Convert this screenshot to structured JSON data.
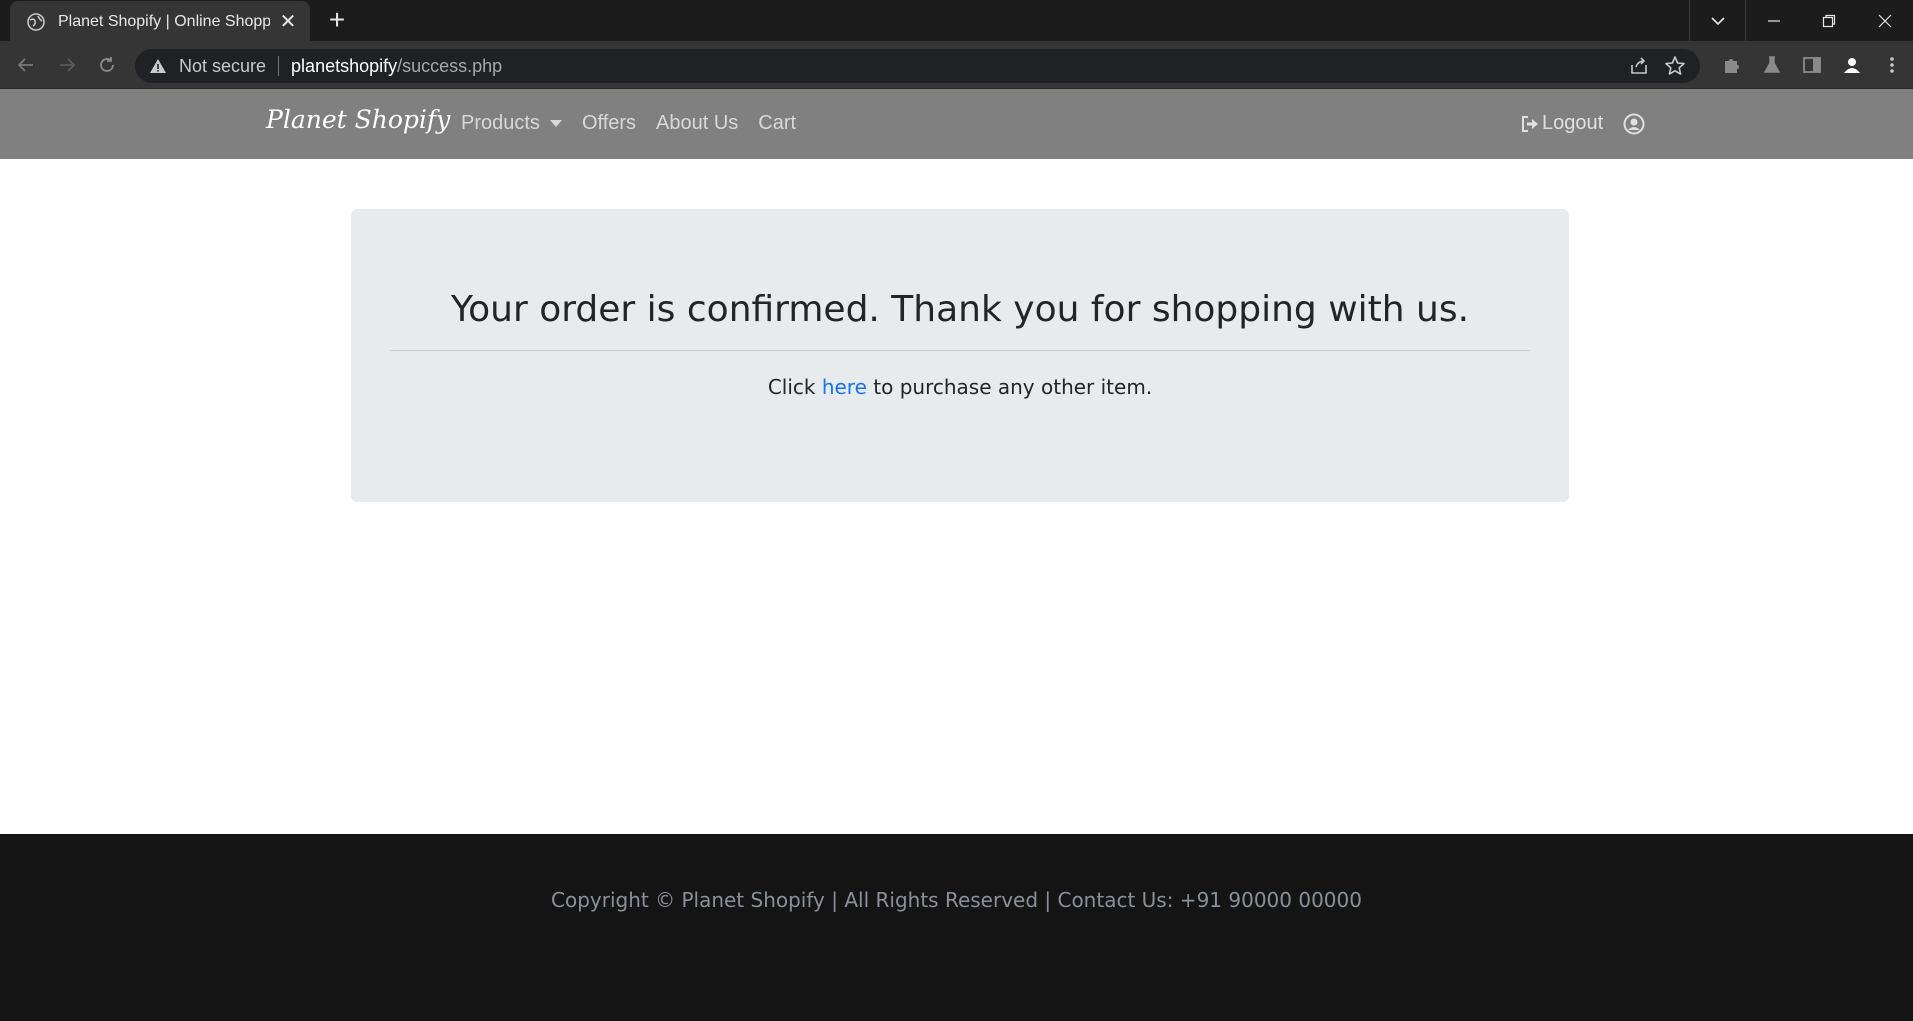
{
  "browser": {
    "tab_title": "Planet Shopify | Online Shopping",
    "tab_close": "✕",
    "new_tab": "+",
    "security_label": "Not secure",
    "url_host": "planetshopify",
    "url_path": "/success.php",
    "icons": [
      "globe-icon",
      "back-icon",
      "forward-icon",
      "reload-icon",
      "warning-icon",
      "share-icon",
      "star-icon",
      "extensions-icon",
      "labs-icon",
      "side-panel-icon",
      "profile-icon",
      "chevron-down-icon",
      "minimize-icon",
      "restore-icon",
      "close-icon"
    ]
  },
  "navbar": {
    "brand": "Planet Shopify",
    "links": [
      "Products",
      "Offers",
      "About Us",
      "Cart"
    ],
    "logout_label": "Logout",
    "icons": [
      "caret-down-icon",
      "logout-icon",
      "user-circle-icon"
    ]
  },
  "main": {
    "heading": "Your order is confirmed. Thank you for shopping with us.",
    "text_before": "Click ",
    "link_text": "here",
    "text_after": " to purchase any other item."
  },
  "footer": {
    "text": "Copyright © Planet Shopify | All Rights Reserved | Contact Us: +91 90000 00000"
  },
  "colors": {
    "navbar_bg": "#808080",
    "jumbotron_bg": "#e8ebee",
    "footer_bg": "#141414",
    "link": "#1a73e8"
  }
}
